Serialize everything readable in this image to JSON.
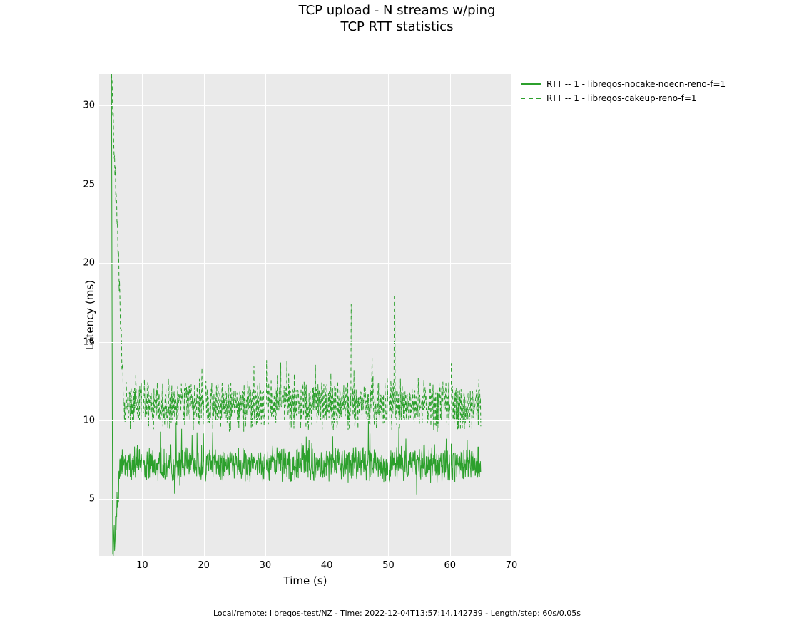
{
  "chart_data": {
    "type": "line",
    "title": "TCP upload - N streams w/ping",
    "subtitle": "TCP RTT statistics",
    "xlabel": "Time (s)",
    "ylabel": "Latency (ms)",
    "xlim": [
      3,
      70
    ],
    "ylim": [
      1.4,
      32
    ],
    "xticks": [
      10,
      20,
      30,
      40,
      50,
      60,
      70
    ],
    "yticks": [
      5,
      10,
      15,
      20,
      25,
      30
    ],
    "color": "#2ca02c",
    "legend_position": "upper-right-outside",
    "grid": true,
    "series": [
      {
        "name": "RTT -- 1 - libreqos-nocake-noecn-reno-f=1",
        "linestyle": "solid",
        "baseline": 7.2,
        "approx_band": [
          6,
          9
        ],
        "initial_spike": {
          "x": 5.0,
          "y": 32
        },
        "notes": "Dense high-frequency series; band values are visually estimated. Early dip reaches ~1.5 ms, after ~6s settles around 6–9 ms with frequent jitter to ~10 ms."
      },
      {
        "name": "RTT -- 1 - libreqos-cakeup-reno-f=1",
        "linestyle": "dashed",
        "baseline": 11,
        "approx_band": [
          9,
          13
        ],
        "spikes": [
          {
            "x": 44,
            "y": 17.4
          },
          {
            "x": 51,
            "y": 17.9
          }
        ],
        "notes": "Dense high-frequency series; after ~7s settles around 9–13 ms with occasional spikes to ~14 ms and two tall spikes near x≈44 and x≈51."
      }
    ],
    "footer": "Local/remote: libreqos-test/NZ - Time: 2022-12-04T13:57:14.142739 - Length/step: 60s/0.05s"
  },
  "legend": {
    "items": [
      {
        "label": "RTT -- 1 - libreqos-nocake-noecn-reno-f=1",
        "style": "solid"
      },
      {
        "label": "RTT -- 1 - libreqos-cakeup-reno-f=1",
        "style": "dashed"
      }
    ]
  }
}
